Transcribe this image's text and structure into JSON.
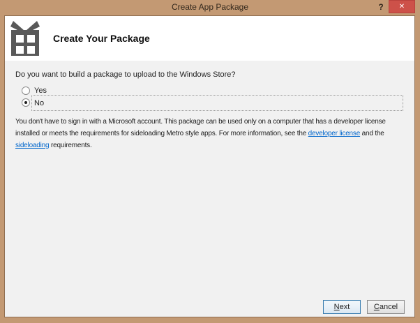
{
  "window": {
    "title": "Create App Package",
    "help_glyph": "?",
    "close_glyph": "✕"
  },
  "header": {
    "title": "Create Your Package",
    "icon": "gift-package-icon"
  },
  "body": {
    "question": "Do you want to build a package to upload to the Windows Store?",
    "options": [
      {
        "label": "Yes",
        "selected": false
      },
      {
        "label": "No",
        "selected": true
      }
    ],
    "note": {
      "part1": "You don't have to sign in with a Microsoft account. This package can be used only on a computer that has a developer license installed or meets the requirements for sideloading Metro style apps. For more information, see the ",
      "link1": "developer license",
      "part2": " and the ",
      "link2": "sideloading",
      "part3": " requirements."
    }
  },
  "buttons": {
    "next": {
      "mnemonic": "N",
      "rest": "ext"
    },
    "cancel": {
      "mnemonic": "C",
      "rest": "ancel"
    }
  },
  "colors": {
    "titlebar_tan": "#c39973",
    "close_button_red": "#cd5149",
    "dialog_bg": "#f1f1f1",
    "header_bg": "#ffffff",
    "icon_gray": "#595959",
    "link_blue": "#0066cc",
    "focused_button_border": "#3c7fb1"
  }
}
